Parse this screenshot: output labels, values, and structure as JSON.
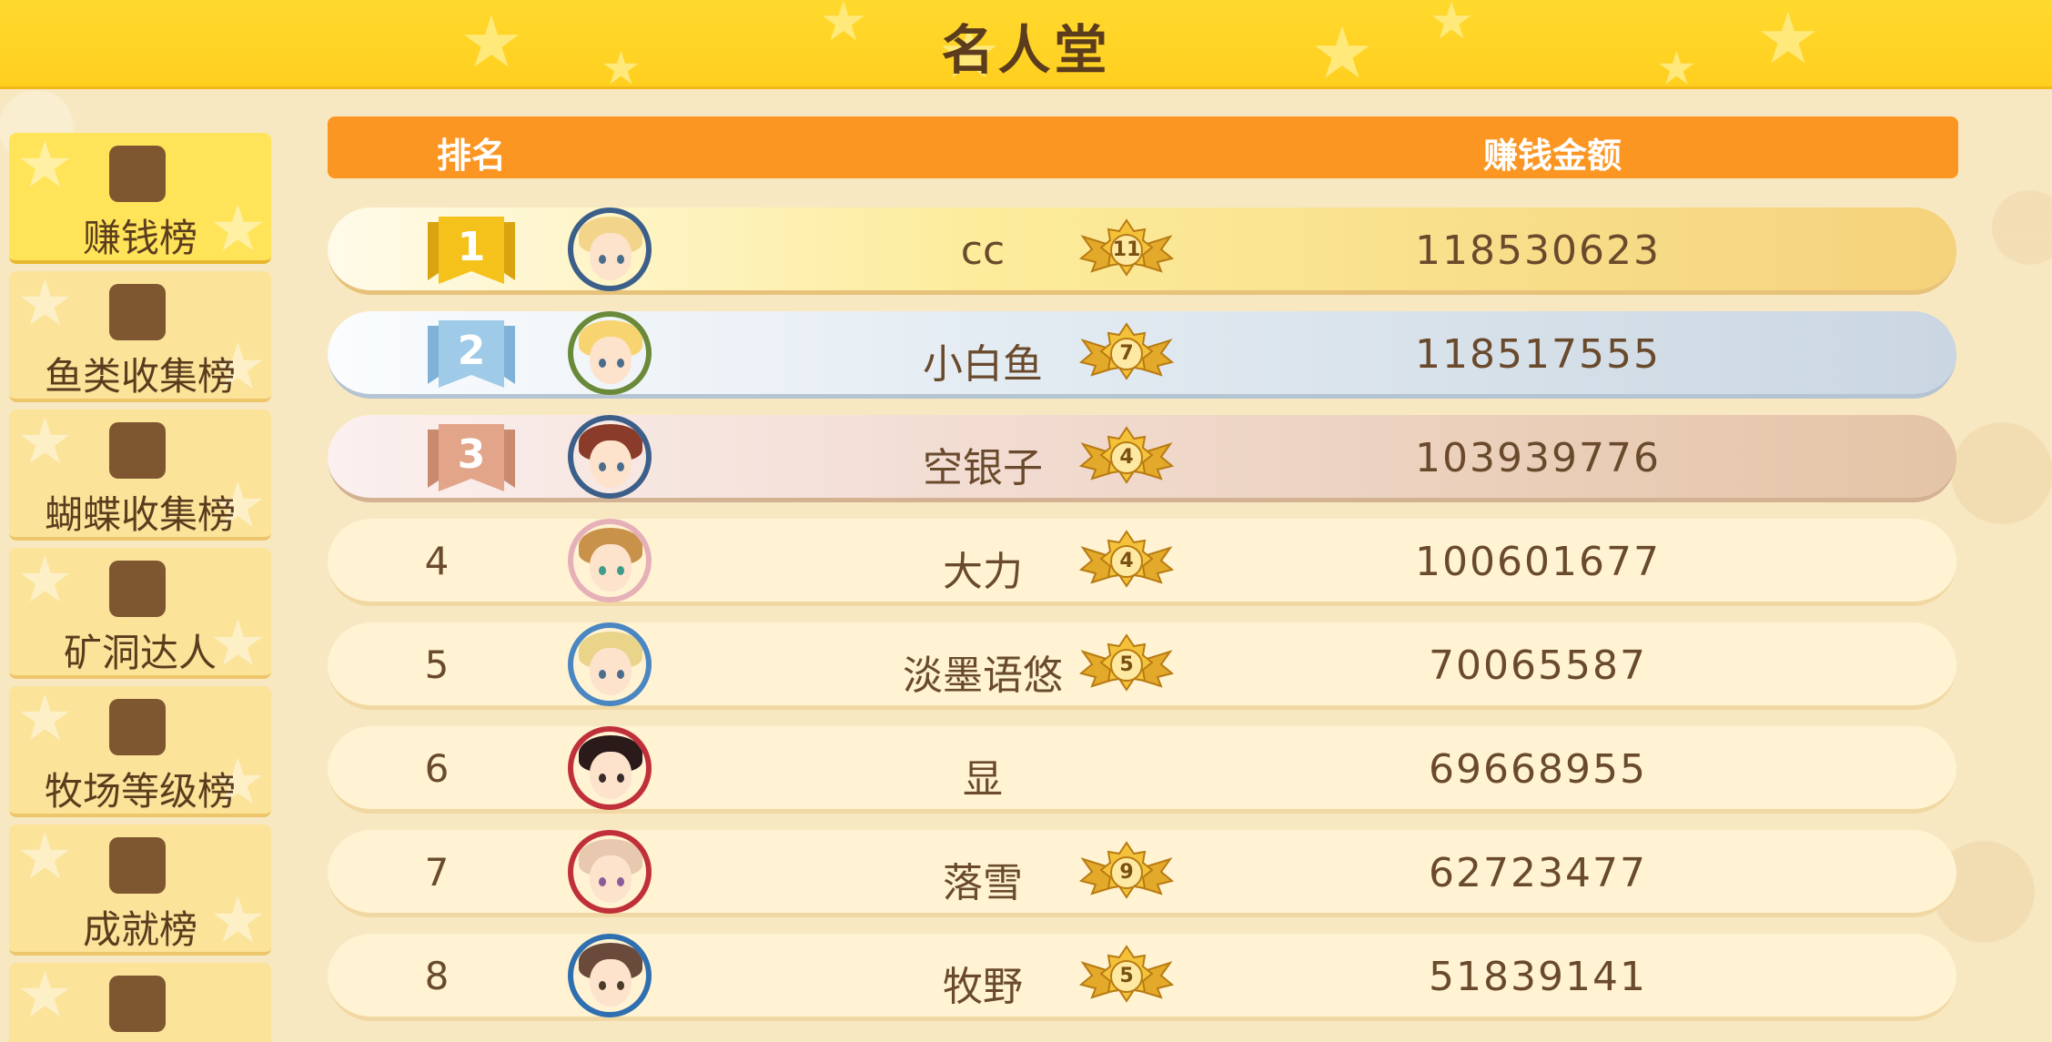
{
  "title": "名人堂",
  "sidebar": {
    "tabs": [
      {
        "label": "赚钱榜"
      },
      {
        "label": "鱼类收集榜"
      },
      {
        "label": "蝴蝶收集榜"
      },
      {
        "label": "矿洞达人"
      },
      {
        "label": "牧场等级榜"
      },
      {
        "label": "成就榜"
      },
      {
        "label": ""
      }
    ]
  },
  "table": {
    "headers": {
      "rank": "排名",
      "money": "赚钱金额"
    },
    "rows": [
      {
        "rank": "1",
        "name": "cc",
        "level": "11",
        "money": "118530623"
      },
      {
        "rank": "2",
        "name": "小白鱼",
        "level": "7",
        "money": "118517555"
      },
      {
        "rank": "3",
        "name": "空银子",
        "level": "4",
        "money": "103939776"
      },
      {
        "rank": "4",
        "name": "大力",
        "level": "4",
        "money": "100601677"
      },
      {
        "rank": "5",
        "name": "淡墨语悠",
        "level": "5",
        "money": "70065587"
      },
      {
        "rank": "6",
        "name": "显",
        "level": "",
        "money": "69668955"
      },
      {
        "rank": "7",
        "name": "落雪",
        "level": "9",
        "money": "62723477"
      },
      {
        "rank": "8",
        "name": "牧野",
        "level": "5",
        "money": "51839141"
      }
    ]
  },
  "colors": {
    "title_bar": "#ffd92e",
    "header_bar": "#fb9623",
    "rank1": "#f4c21a",
    "rank2": "#9fcbe8",
    "rank3": "#e2a58a"
  }
}
